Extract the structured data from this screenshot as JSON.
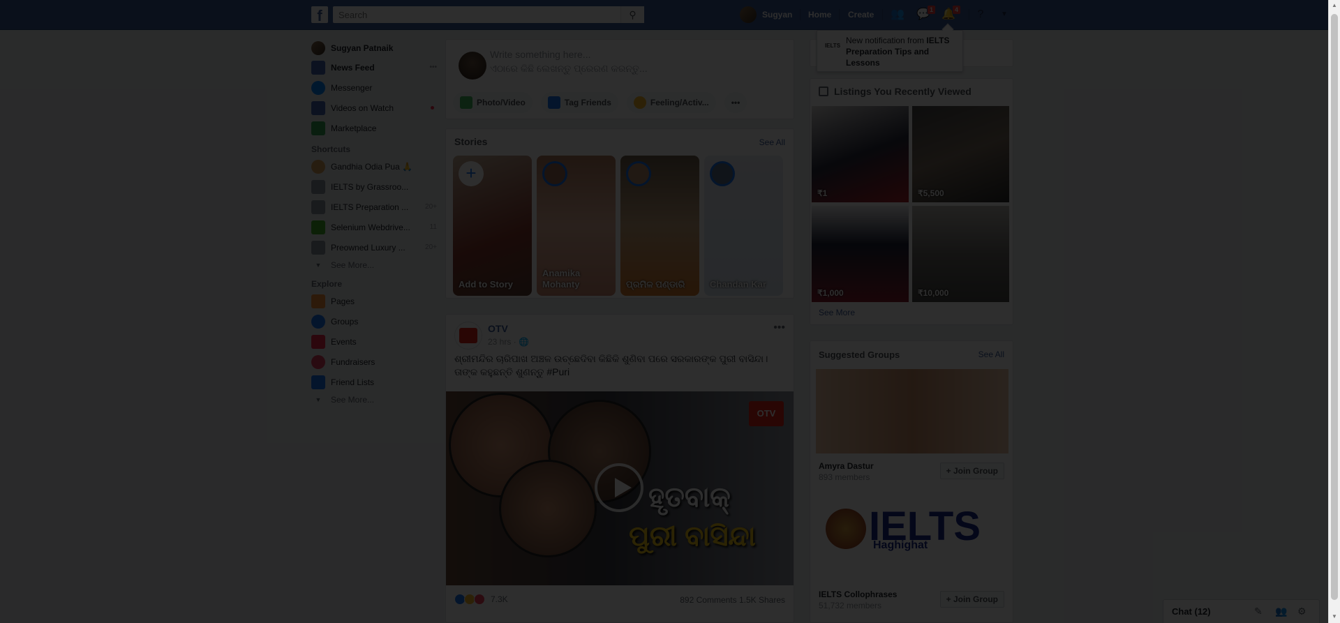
{
  "header": {
    "logo": "f",
    "search_placeholder": "Search",
    "user_name": "Sugyan",
    "nav": [
      "Home",
      "Create"
    ],
    "badges": {
      "messages": "1",
      "notifications": "4"
    },
    "colors": {
      "brand": "#3b5998",
      "badge": "#fa3e3e"
    }
  },
  "notification_popup": {
    "thumb_text": "IELTS",
    "text_prefix": "New notification from",
    "text_bold": "IELTS Preparation Tips and Lessons"
  },
  "left_nav": {
    "user": "Sugyan Patnaik",
    "main": [
      {
        "label": "News Feed",
        "icon": "news-feed-icon",
        "extra": "•••"
      },
      {
        "label": "Messenger",
        "icon": "messenger-icon"
      },
      {
        "label": "Videos on Watch",
        "icon": "watch-icon"
      },
      {
        "label": "Marketplace",
        "icon": "marketplace-icon"
      }
    ],
    "shortcuts_title": "Shortcuts",
    "shortcuts": [
      {
        "label": "Gandhia Odia Pua 🙏",
        "extra": ""
      },
      {
        "label": "IELTS by Grassroo...",
        "extra": ""
      },
      {
        "label": "IELTS Preparation ...",
        "extra": "20+"
      },
      {
        "label": "Selenium Webdrive...",
        "extra": "11"
      },
      {
        "label": "Preowned Luxury ...",
        "extra": "20+"
      }
    ],
    "see_more": "See More...",
    "explore_title": "Explore",
    "explore": [
      {
        "label": "Pages",
        "icon": "pages-icon"
      },
      {
        "label": "Groups",
        "icon": "groups-icon"
      },
      {
        "label": "Events",
        "icon": "events-icon"
      },
      {
        "label": "Fundraisers",
        "icon": "fundraisers-icon"
      },
      {
        "label": "Friend Lists",
        "icon": "friend-lists-icon"
      }
    ],
    "see_more_2": "See More..."
  },
  "composer": {
    "placeholder_en": "Write something here...",
    "placeholder_or": "ଏଠାରେ କିଛି ଲେଖନ୍ତୁ ପ୍ରେରଣ କରନ୍ତୁ...",
    "actions": [
      "Photo/Video",
      "Tag Friends",
      "Feeling/Activ...",
      "•••"
    ]
  },
  "stories": {
    "title": "Stories",
    "see_all": "See All",
    "items": [
      "Add to Story",
      "Anamika Mohanty",
      "ପ୍ରମିଳ ପଣ୍ଡାରି",
      "Chandan Kar"
    ]
  },
  "post": {
    "author": "OTV",
    "time": "23 hrs · ",
    "text": "ଶ୍ରୀମନ୍ଦିର ଚାରିପାଖ ଅଞ୍ଚଳ ଉଚ୍ଛେଦିବା କିଛିକି ଶୁଣିବା ପରେ ସରକାରଙ୍କ ପୁରୀ ବାସିନ୍ଦା। ତାଙ୍କ କହୁଛନ୍ତି ଶୁଣନ୍ତୁ #Puri",
    "video_line1": "ହୃତବାକ୍",
    "video_line2": "ପୁରୀ ବାସିନ୍ଦା",
    "video_logo": "OTV",
    "reactions": "7.3K",
    "comments_shares": "892 Comments  1.5K Shares"
  },
  "listings": {
    "title": "Listings You Recently Viewed",
    "prices": [
      "₹1",
      "₹5,500",
      "₹1,000",
      "₹10,000"
    ],
    "see_more": "See More"
  },
  "suggested_groups": {
    "title": "Suggested Groups",
    "see_all": "See All",
    "groups": [
      {
        "name": "Amyra Dastur",
        "members": "893 members",
        "join": "Join Group"
      },
      {
        "name": "IELTS Collophrases",
        "members": "51,732 members",
        "join": "Join Group"
      }
    ],
    "ielts_word": "IELTS",
    "ielts_sub": "Haghighat"
  },
  "chat": {
    "label": "Chat (12)"
  }
}
